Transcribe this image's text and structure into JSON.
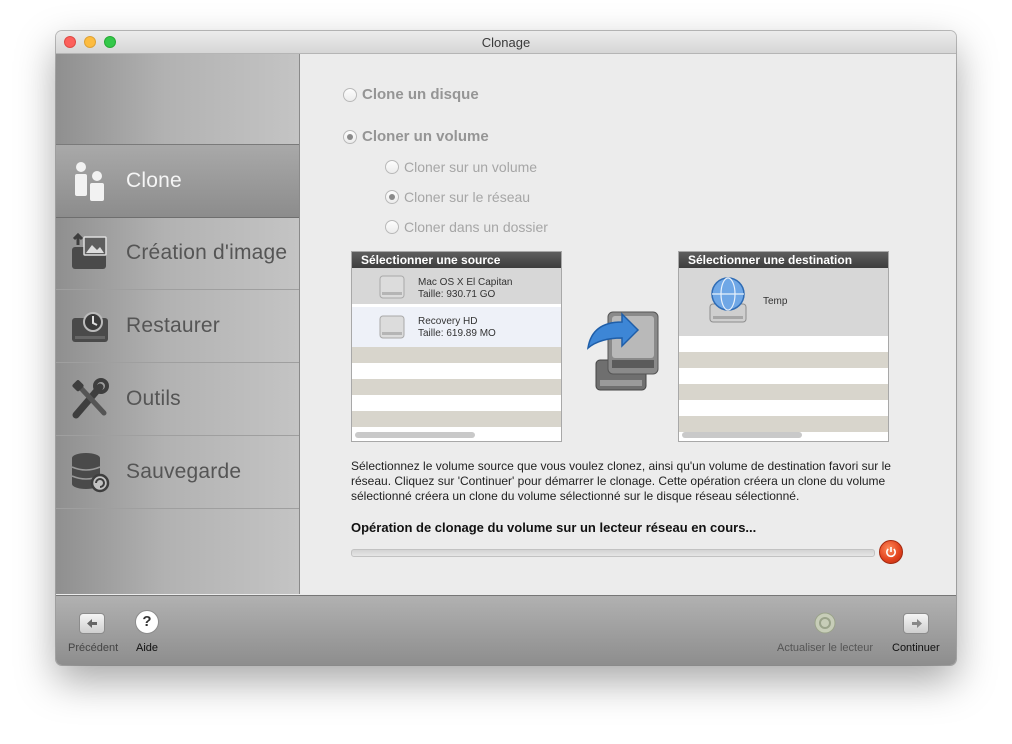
{
  "window": {
    "title": "Clonage"
  },
  "sidebar": {
    "items": [
      {
        "label": "Clone",
        "icon": "clone-person-icon",
        "active": true
      },
      {
        "label": "Création d'image",
        "icon": "image-drive-icon",
        "active": false
      },
      {
        "label": "Restaurer",
        "icon": "restore-drive-icon",
        "active": false
      },
      {
        "label": "Outils",
        "icon": "tools-icon",
        "active": false
      },
      {
        "label": "Sauvegarde",
        "icon": "backup-database-icon",
        "active": false
      }
    ]
  },
  "options": {
    "clone_disk": "Clone un disque",
    "clone_volume": "Cloner un volume",
    "sub": [
      {
        "label": "Cloner sur un volume",
        "selected": false
      },
      {
        "label": "Cloner sur le réseau",
        "selected": true
      },
      {
        "label": "Cloner dans un dossier",
        "selected": false
      }
    ]
  },
  "source_panel": {
    "header": "Sélectionner une source",
    "items": [
      {
        "name": "Mac OS X El Capitan",
        "size": "Taille: 930.71 GO"
      },
      {
        "name": "Recovery HD",
        "size": "Taille: 619.89 MO"
      }
    ]
  },
  "destination_panel": {
    "header": "Sélectionner une destination",
    "items": [
      {
        "name": "Temp"
      }
    ]
  },
  "description": "Sélectionnez le volume source que vous voulez clonez, ainsi qu'un volume de destination favori sur le réseau. Cliquez sur 'Continuer' pour démarrer le clonage. Cette opération créera un clone du volume sélectionné créera un clone du volume sélectionné sur le disque réseau sélectionné.",
  "status": "Opération de clonage du volume sur un lecteur réseau en cours...",
  "progress": 0,
  "bottom": {
    "previous": "Précédent",
    "help": "Aide",
    "help_glyph": "?",
    "refresh": "Actualiser le lecteur",
    "continue": "Continuer"
  },
  "colors": {
    "stop_button": "#e0401c",
    "active_sidebar": "#8c8c8c"
  }
}
